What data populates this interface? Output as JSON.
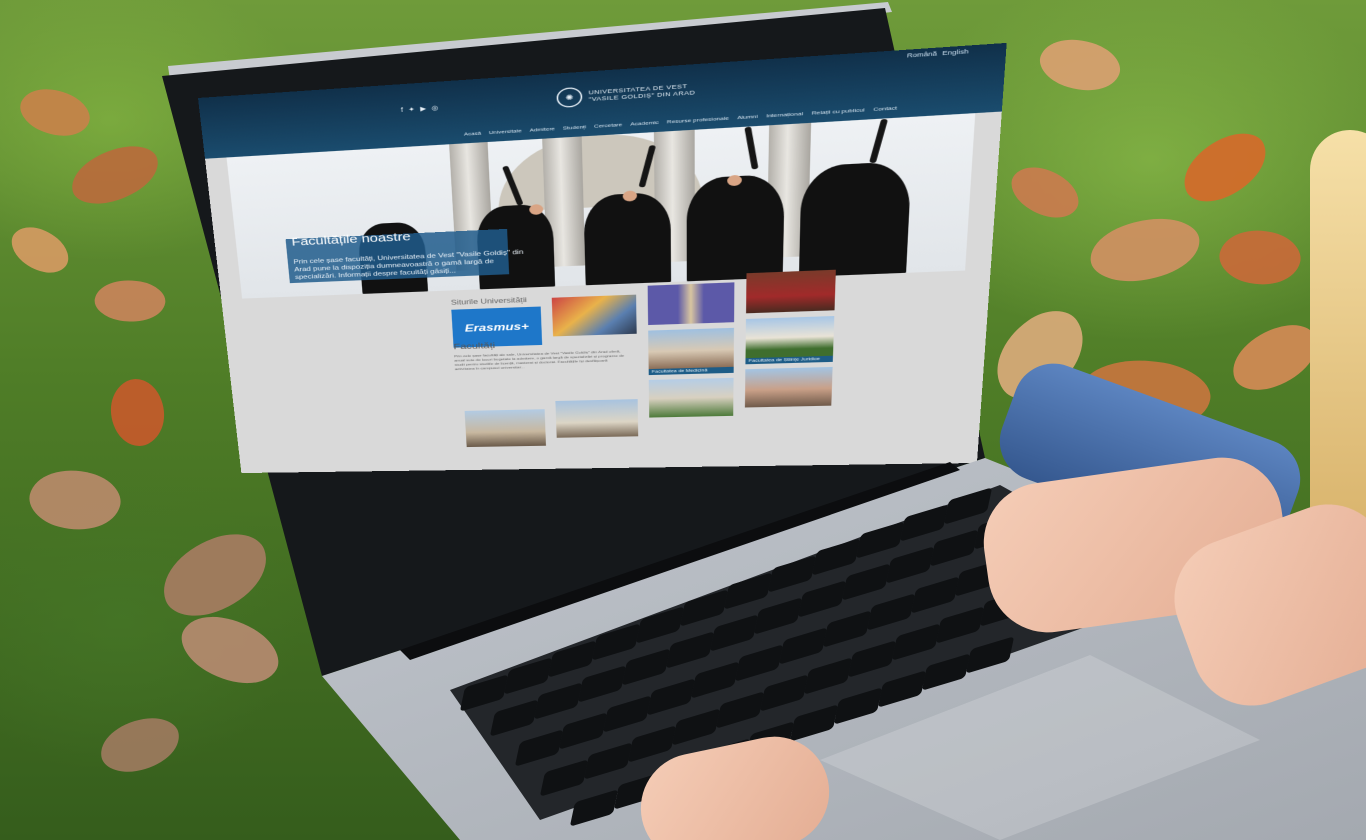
{
  "colors": {
    "header": "#10304a",
    "accent": "#1e77c9",
    "caption": "#1d5c87"
  },
  "site": {
    "lang": [
      "Română",
      "English"
    ],
    "social_icons": [
      "facebook-icon",
      "twitter-icon",
      "youtube-icon",
      "instagram-icon"
    ],
    "logo_line1": "UNIVERSITATEA DE VEST",
    "logo_line2": "\"VASILE GOLDIȘ\" DIN ARAD",
    "nav": [
      "Acasă",
      "Universitate",
      "Admitere",
      "Studenți",
      "Cercetare",
      "Academic",
      "Resurse profesionale",
      "Alumni",
      "Internațional",
      "Relații cu publicul",
      "Contact"
    ]
  },
  "hero": {
    "title": "Facultățile noastre",
    "body": "Prin cele șase facultăți, Universitatea de Vest \"Vasile Goldiș\" din Arad pune la dispoziția dumneavoastră o gamă largă de specializări. Informații despre facultăți găsiți..."
  },
  "sites": {
    "title": "Siturile Universității",
    "erasmus_label": "Erasmus+"
  },
  "faculties": {
    "title": "Facultăți",
    "body": "Prin cele șase facultăți ale sale, Universitatea de Vest \"Vasile Goldiș\" din Arad oferă, anual sute de locuri bugetate la admitere, o gamă largă de specializări și programe de studii pentru studiile de licență, masterat și doctorat. Facultățile își desfășoară activitatea în campusul universitar...",
    "captions": [
      "Facultatea de Medicină",
      "Facultatea de Științe Juridice"
    ]
  }
}
